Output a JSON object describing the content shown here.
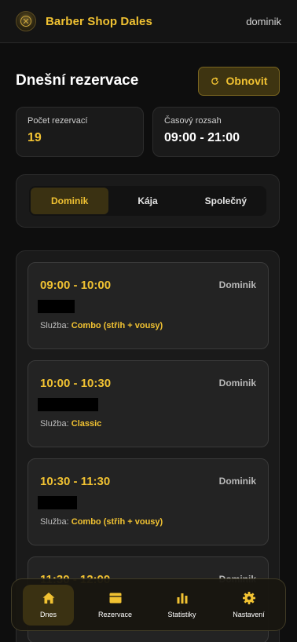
{
  "app": {
    "brand": "Barber Shop Dales",
    "user": "dominik"
  },
  "page": {
    "title": "Dnešní rezervace",
    "refresh_label": "Obnovit"
  },
  "stats": [
    {
      "label": "Počet rezervací",
      "value": "19"
    },
    {
      "label": "Časový rozsah",
      "value": "09:00 - 21:00"
    }
  ],
  "barber_tabs": [
    {
      "label": "Dominik",
      "active": true
    },
    {
      "label": "Kája",
      "active": false
    },
    {
      "label": "Společný",
      "active": false
    }
  ],
  "service_prefix": "Služba:",
  "reservations": [
    {
      "time": "09:00 - 10:00",
      "barber": "Dominik",
      "customer_redacted": true,
      "service": "Combo (střih + vousy)"
    },
    {
      "time": "10:00 - 10:30",
      "barber": "Dominik",
      "customer_redacted": true,
      "service": "Classic"
    },
    {
      "time": "10:30 - 11:30",
      "barber": "Dominik",
      "customer_redacted": true,
      "service": "Combo (střih + vousy)"
    },
    {
      "time": "11:30 - 12:00",
      "barber": "Dominik",
      "customer_redacted": true,
      "service": ""
    }
  ],
  "bottom_nav": [
    {
      "label": "Dnes",
      "icon": "home-icon",
      "active": true
    },
    {
      "label": "Rezervace",
      "icon": "calendar-icon",
      "active": false
    },
    {
      "label": "Statistiky",
      "icon": "bar-chart-icon",
      "active": false
    },
    {
      "label": "Nastavení",
      "icon": "gear-icon",
      "active": false
    }
  ],
  "colors": {
    "accent": "#f1c232",
    "background": "#0e0e0e",
    "card": "#1a1a1a",
    "active_bg": "#3a3112"
  }
}
